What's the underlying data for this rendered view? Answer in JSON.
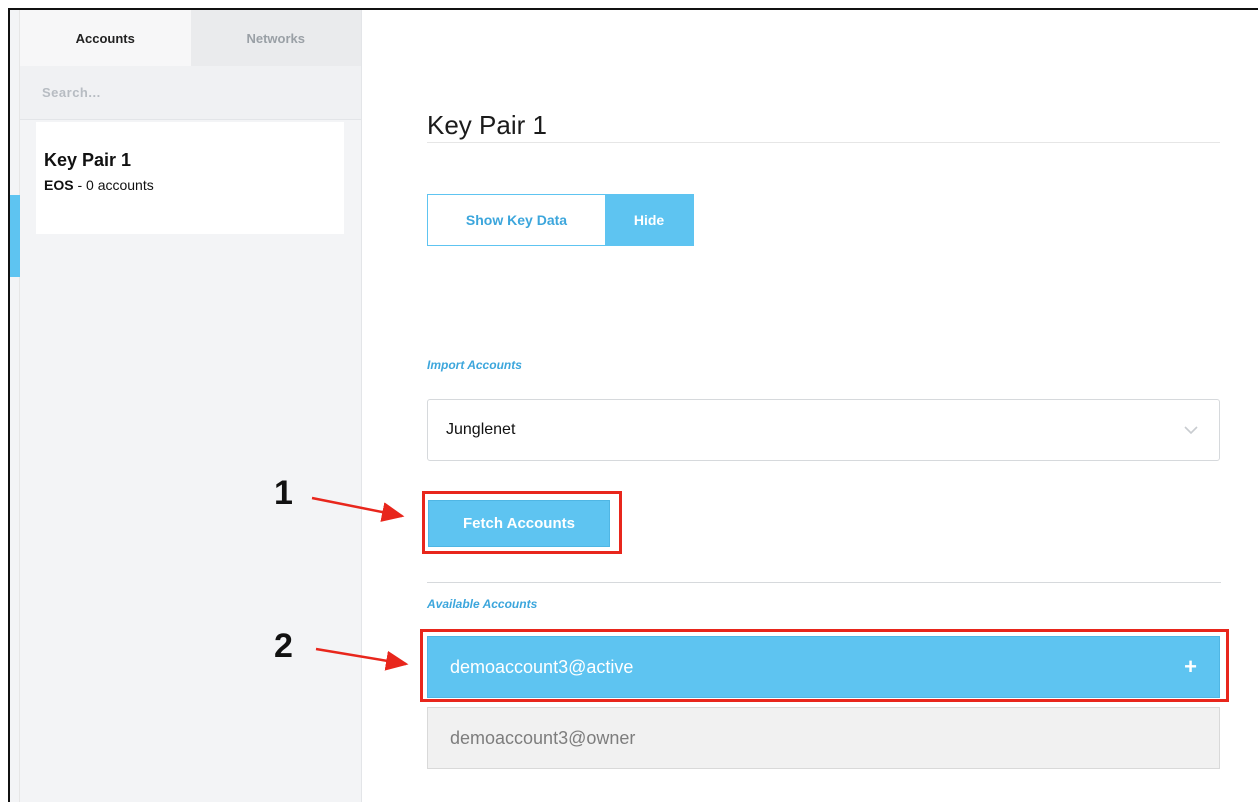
{
  "sidebar": {
    "tabs": [
      {
        "label": "Accounts",
        "active": true
      },
      {
        "label": "Networks",
        "active": false
      }
    ],
    "search_placeholder": "Search...",
    "keypair": {
      "name": "Key Pair 1",
      "blockchain": "EOS",
      "accounts_text": " - 0 accounts"
    }
  },
  "main": {
    "title": "Key Pair 1",
    "key_toggle": {
      "show_label": "Show Key Data",
      "hide_label": "Hide"
    },
    "import_section_label": "Import Accounts",
    "network_select": {
      "value": "Junglenet"
    },
    "fetch_button_label": "Fetch Accounts",
    "available_section_label": "Available Accounts",
    "accounts": [
      {
        "label": "demoaccount3@active",
        "selected": true
      },
      {
        "label": "demoaccount3@owner",
        "selected": false
      }
    ]
  },
  "annotations": {
    "step1": "1",
    "step2": "2"
  },
  "colors": {
    "accent": "#5ec4f1",
    "accent_text": "#3ca6dc",
    "highlight": "#e8261c"
  },
  "icons": {
    "select_chevron": "chevron-down-icon",
    "add_account": "plus-icon"
  }
}
